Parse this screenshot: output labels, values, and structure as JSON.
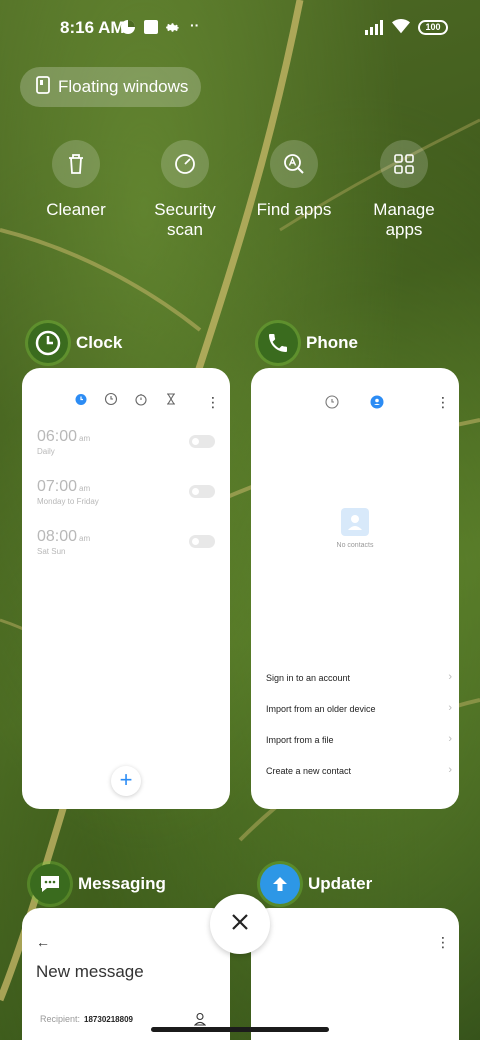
{
  "status_bar": {
    "time": "8:16 AM",
    "battery": "100",
    "icons": [
      "data-saver-icon",
      "square-notification-icon",
      "gear-icon",
      "more-dots-icon",
      "signal-icon",
      "wifi-icon"
    ]
  },
  "floating_windows": {
    "label": "Floating windows",
    "icon": "floating-window-icon"
  },
  "tools": [
    {
      "label": "Cleaner",
      "icon": "trash-icon"
    },
    {
      "label": "Security\nscan",
      "icon": "security-scan-icon"
    },
    {
      "label": "Find apps",
      "icon": "find-apps-icon"
    },
    {
      "label": "Manage\napps",
      "icon": "grid-icon"
    }
  ],
  "apps": {
    "clock": {
      "name": "Clock",
      "alarms": [
        {
          "time": "06:00",
          "ampm": "am",
          "days": "Daily"
        },
        {
          "time": "07:00",
          "ampm": "am",
          "days": "Monday to Friday"
        },
        {
          "time": "08:00",
          "ampm": "am",
          "days": "Sat Sun"
        }
      ],
      "fab": "+"
    },
    "phone": {
      "name": "Phone",
      "empty_text": "No contacts",
      "options": [
        "Sign in to an account",
        "Import from an older device",
        "Import from a file",
        "Create a new contact"
      ]
    },
    "messaging": {
      "name": "Messaging",
      "title": "New message",
      "recipient_label": "Recipient:",
      "recipient_number": "18730218809"
    },
    "updater": {
      "name": "Updater"
    }
  },
  "colors": {
    "accent_blue": "#2c8cf4",
    "card_bg": "#ffffff"
  }
}
